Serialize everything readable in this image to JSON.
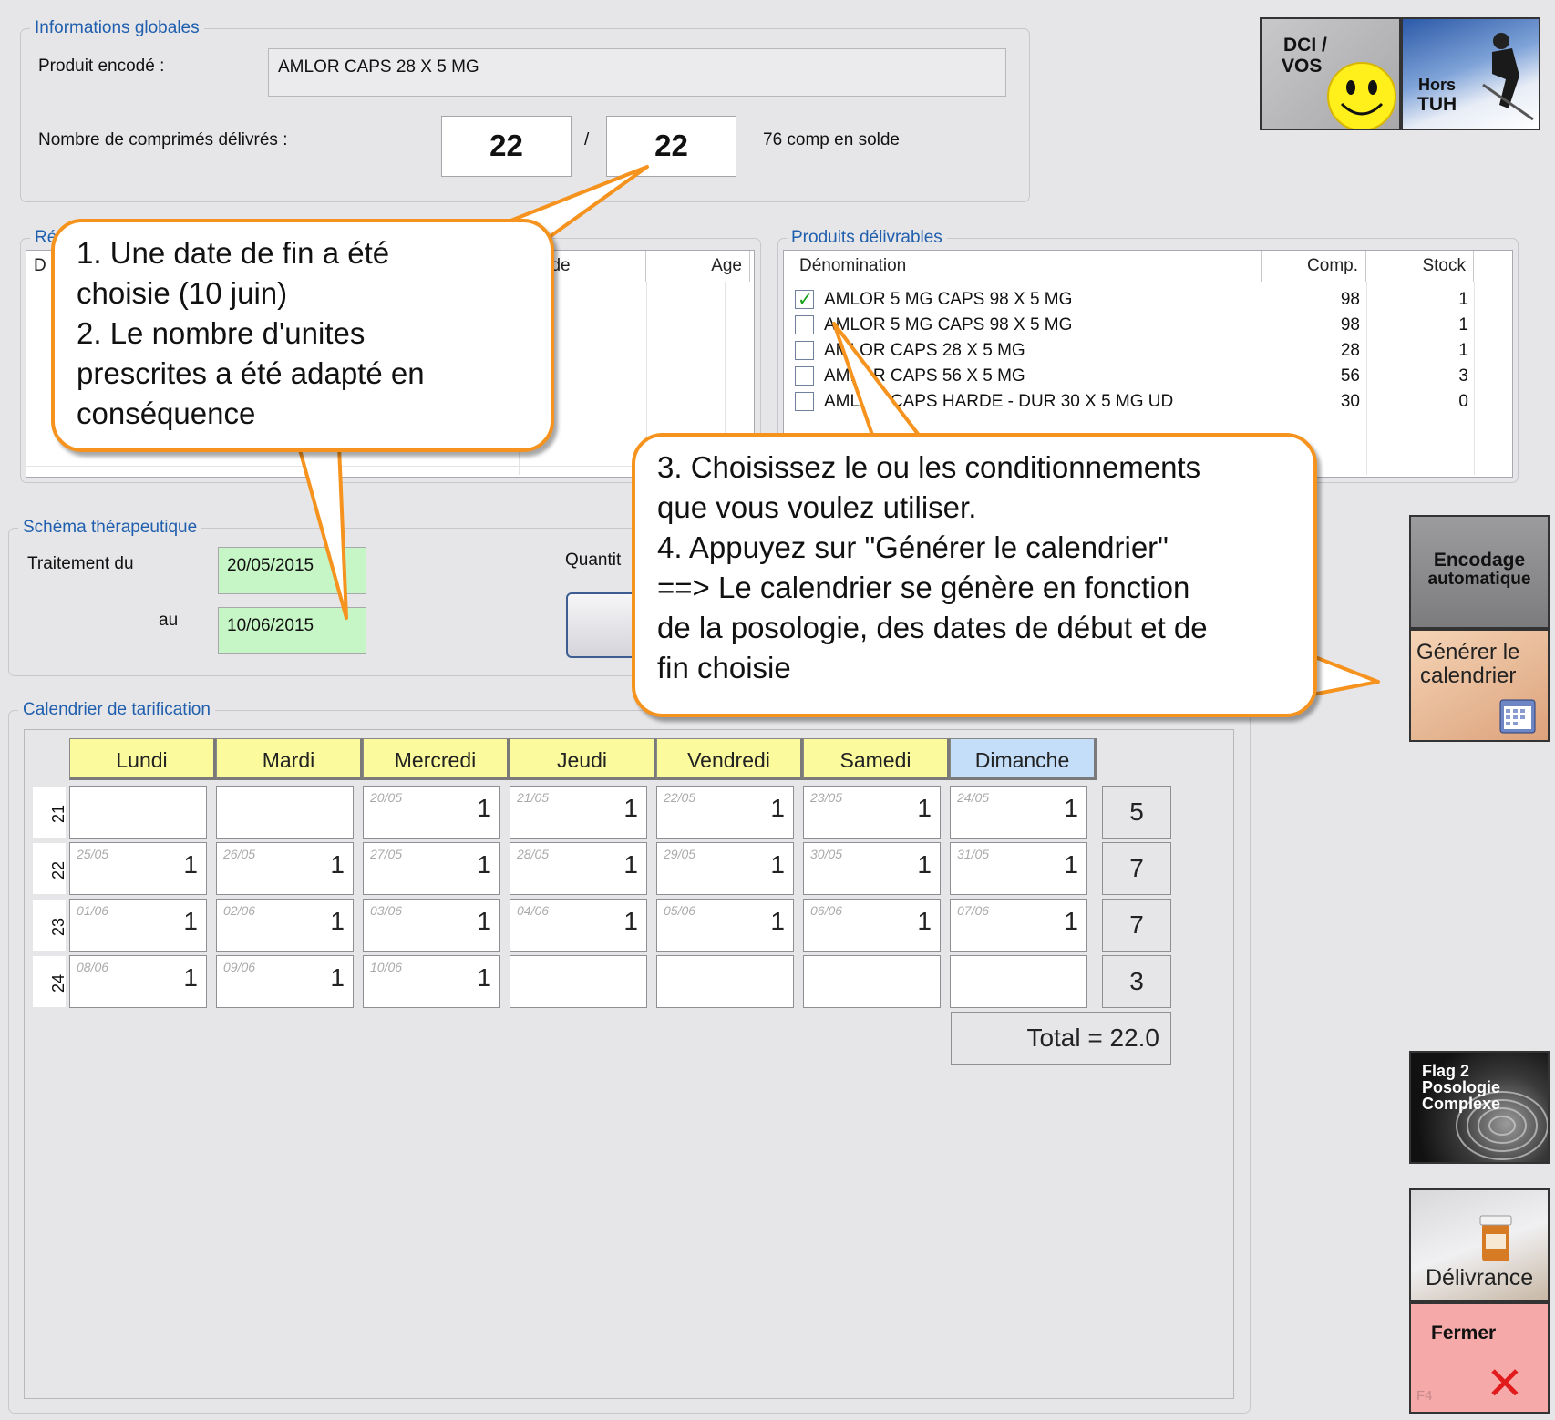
{
  "global_info": {
    "legend": "Informations globales",
    "product_label": "Produit encodé :",
    "product_value": "AMLOR CAPS 28 X 5 MG",
    "count_label": "Nombre de comprimés délivrés :",
    "count_delivered": "22",
    "separator": "/",
    "count_total": "22",
    "balance_text": "76 comp en solde"
  },
  "left_list": {
    "legend_fragment": "Rés",
    "col1": "D",
    "col_solde": "Solde",
    "col_age": "Age"
  },
  "products": {
    "legend": "Produits délivrables",
    "col_name": "Dénomination",
    "col_comp": "Comp.",
    "col_stock": "Stock",
    "rows": [
      {
        "checked": true,
        "name": "AMLOR 5 MG CAPS 98 X 5 MG",
        "comp": "98",
        "stock": "1"
      },
      {
        "checked": false,
        "name": "AMLOR 5 MG CAPS 98 X 5 MG",
        "comp": "98",
        "stock": "1"
      },
      {
        "checked": false,
        "name": "AMLOR CAPS 28 X 5 MG",
        "comp": "28",
        "stock": "1"
      },
      {
        "checked": false,
        "name": "AMLOR CAPS 56 X 5 MG",
        "comp": "56",
        "stock": "3"
      },
      {
        "checked": false,
        "name": "AMLOR CAPS HARDE - DUR 30 X 5 MG UD",
        "comp": "30",
        "stock": "0"
      }
    ]
  },
  "schema": {
    "legend": "Schéma thérapeutique",
    "from_label": "Traitement du",
    "from_value": "20/05/2015",
    "to_label": "au",
    "to_value": "10/06/2015",
    "quantity_label": "Quantit"
  },
  "calendar": {
    "legend": "Calendrier de tarification",
    "days": [
      "Lundi",
      "Mardi",
      "Mercredi",
      "Jeudi",
      "Vendredi",
      "Samedi",
      "Dimanche"
    ],
    "weeks": [
      {
        "week": "21",
        "cells": [
          null,
          null,
          {
            "date": "20/05",
            "value": "1"
          },
          {
            "date": "21/05",
            "value": "1"
          },
          {
            "date": "22/05",
            "value": "1"
          },
          {
            "date": "23/05",
            "value": "1"
          },
          {
            "date": "24/05",
            "value": "1"
          }
        ],
        "sum": "5"
      },
      {
        "week": "22",
        "cells": [
          {
            "date": "25/05",
            "value": "1"
          },
          {
            "date": "26/05",
            "value": "1"
          },
          {
            "date": "27/05",
            "value": "1"
          },
          {
            "date": "28/05",
            "value": "1"
          },
          {
            "date": "29/05",
            "value": "1"
          },
          {
            "date": "30/05",
            "value": "1"
          },
          {
            "date": "31/05",
            "value": "1"
          }
        ],
        "sum": "7"
      },
      {
        "week": "23",
        "cells": [
          {
            "date": "01/06",
            "value": "1"
          },
          {
            "date": "02/06",
            "value": "1"
          },
          {
            "date": "03/06",
            "value": "1"
          },
          {
            "date": "04/06",
            "value": "1"
          },
          {
            "date": "05/06",
            "value": "1"
          },
          {
            "date": "06/06",
            "value": "1"
          },
          {
            "date": "07/06",
            "value": "1"
          }
        ],
        "sum": "7"
      },
      {
        "week": "24",
        "cells": [
          {
            "date": "08/06",
            "value": "1"
          },
          {
            "date": "09/06",
            "value": "1"
          },
          {
            "date": "10/06",
            "value": "1"
          },
          null,
          null,
          null,
          null
        ],
        "sum": "3"
      }
    ],
    "total": "Total = 22.0"
  },
  "side_buttons": {
    "dci_line1": "DCI /",
    "dci_line2": "VOS",
    "hors": "Hors",
    "tuh": "TUH",
    "encodage_line1": "Encodage",
    "encodage_line2": "automatique",
    "generer_line1": "Générer le",
    "generer_line2": "calendrier",
    "flag_line1": "Flag 2",
    "flag_line2": "Posologie",
    "flag_line3": "Complexe",
    "delivrance": "Délivrance",
    "fermer": "Fermer",
    "fermer_key": "F4"
  },
  "callouts": {
    "c1": [
      "1. Une date de fin a été",
      "choisie (10 juin)",
      "2. Le nombre d'unites",
      "prescrites a été adapté en",
      "conséquence"
    ],
    "c2": [
      "3. Choisissez le ou les conditionnements",
      "que vous voulez utiliser.",
      "4. Appuyez sur \"Générer le calendrier\"",
      "==> Le calendrier se génère en fonction",
      "de la posologie, des dates de début et de",
      "fin choisie"
    ]
  },
  "colors": {
    "accent_orange": "#f5931e",
    "legend_blue": "#1f5fae",
    "date_green": "#c6f5c6",
    "day_yellow": "#fbfb9d",
    "sunday_blue": "#c4def9",
    "close_red": "#f6a9a9"
  }
}
